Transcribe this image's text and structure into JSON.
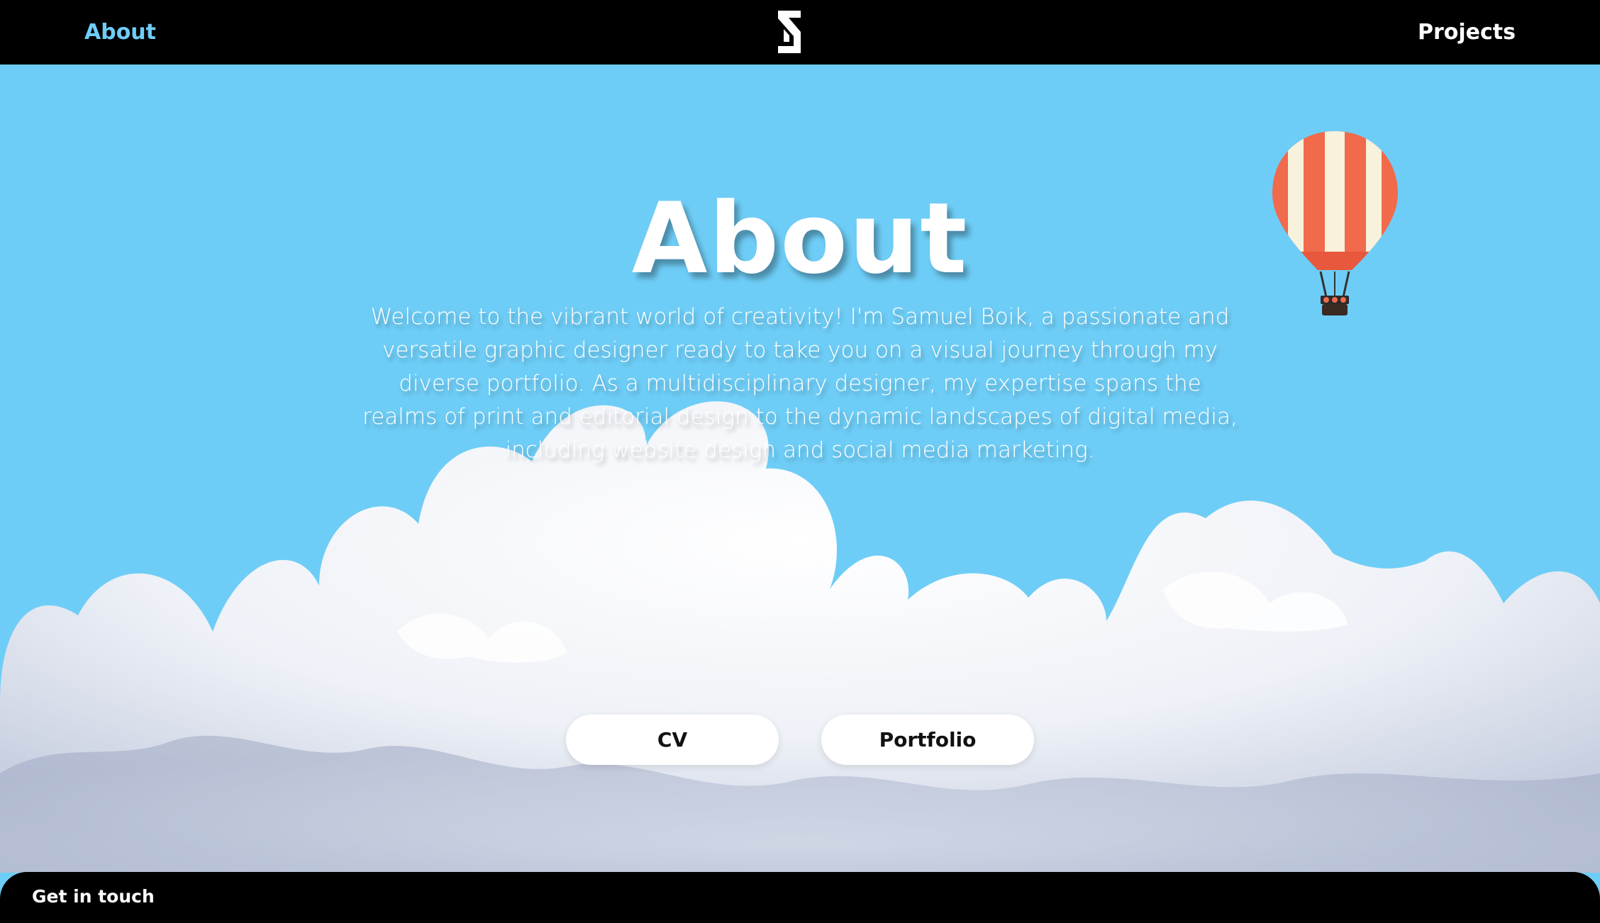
{
  "nav": {
    "about_label": "About",
    "projects_label": "Projects",
    "logo_icon": "s-monogram-logo",
    "active_color": "#6ecdf6"
  },
  "hero": {
    "title": "About",
    "intro": "Welcome to the vibrant world of creativity! I'm Samuel Boik, a passionate and versatile graphic designer ready to take you on a visual journey through my diverse portfolio. As a multidisciplinary designer, my expertise spans the realms of print and editorial design to the dynamic landscapes of digital media, including website design and social media marketing.",
    "sky_color": "#6ecdf6",
    "balloon_icon": "hot-air-balloon-icon",
    "clouds_image": "clouds-illustration"
  },
  "actions": {
    "cv_label": "CV",
    "portfolio_label": "Portfolio"
  },
  "footer": {
    "contact_label": "Get in touch"
  }
}
